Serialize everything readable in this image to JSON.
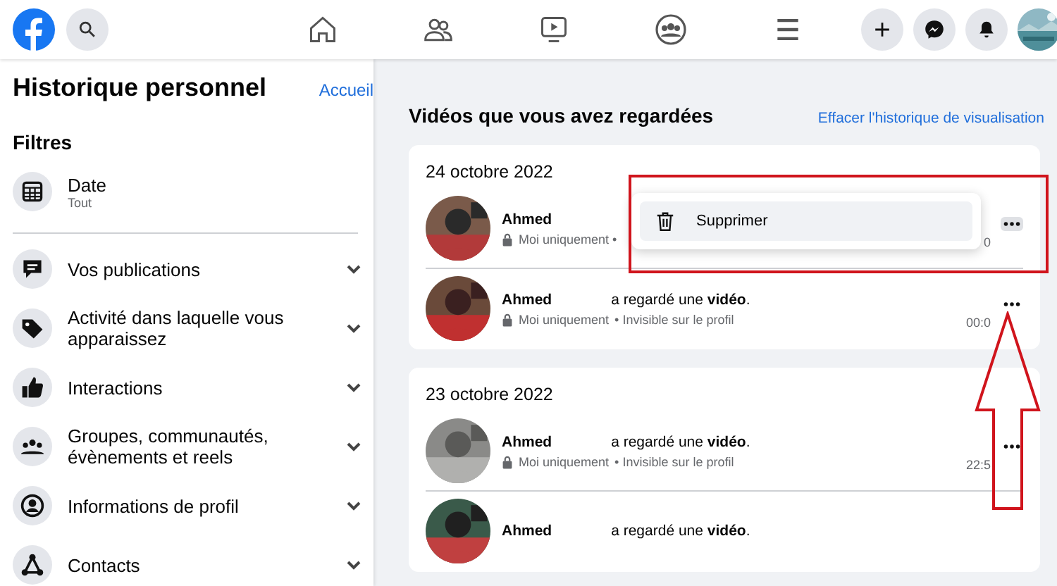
{
  "sidebar": {
    "title": "Historique personnel",
    "home_link": "Accueil",
    "filters_heading": "Filtres",
    "items": [
      {
        "kind": "filter",
        "label": "Date",
        "value": "Tout"
      },
      {
        "kind": "category",
        "label": "Vos publications",
        "expanded": false
      },
      {
        "kind": "category",
        "label": "Activité dans laquelle vous apparaissez",
        "expanded": false
      },
      {
        "kind": "category",
        "label": "Interactions",
        "expanded": false
      },
      {
        "kind": "category",
        "label": "Groupes, communautés, évènements et reels",
        "expanded": false
      },
      {
        "kind": "category",
        "label": "Informations de profil",
        "expanded": false
      },
      {
        "kind": "category",
        "label": "Contacts",
        "expanded": false
      }
    ]
  },
  "main": {
    "title": "Vidéos que vous avez regardées",
    "clear_link": "Effacer l'historique de visualisation",
    "days": [
      {
        "date": "24 octobre 2022",
        "entries": [
          {
            "name": "Ahmed",
            "audience": "Moi uniquement •",
            "time": "0",
            "menu_open": true
          },
          {
            "name": "Ahmed",
            "action": "a regardé une **vidéo**.",
            "audience": "Moi uniquement",
            "visibility": "• Invisible sur le profil",
            "time": "00:0",
            "menu_open": false
          }
        ]
      },
      {
        "date": "23 octobre 2022",
        "entries": [
          {
            "name": "Ahmed",
            "action": "a regardé une **vidéo**.",
            "audience": "Moi uniquement",
            "visibility": "• Invisible sur le profil",
            "time": "22:5",
            "menu_open": false
          },
          {
            "name": "Ahmed",
            "action": "a regardé une **vidéo**."
          }
        ]
      }
    ]
  },
  "context_menu": {
    "items": [
      {
        "label": "Supprimer",
        "selected": true
      }
    ]
  }
}
